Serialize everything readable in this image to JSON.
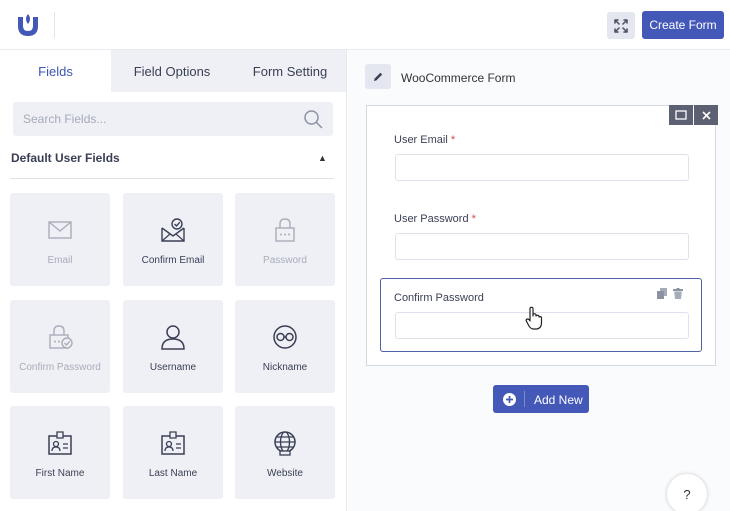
{
  "header": {
    "create_label": "Create Form",
    "brand_color": "#4458b8"
  },
  "tabs": [
    {
      "label": "Fields",
      "active": true
    },
    {
      "label": "Field Options",
      "active": false
    },
    {
      "label": "Form Setting",
      "active": false
    }
  ],
  "search": {
    "placeholder": "Search Fields...",
    "value": ""
  },
  "section": {
    "title": "Default User Fields",
    "expanded": true
  },
  "fields": [
    {
      "label": "Email",
      "icon": "envelope-icon",
      "muted": true
    },
    {
      "label": "Confirm Email",
      "icon": "envelope-check-icon",
      "muted": false
    },
    {
      "label": "Password",
      "icon": "lock-icon",
      "muted": true
    },
    {
      "label": "Confirm Password",
      "icon": "lock-check-icon",
      "muted": true
    },
    {
      "label": "Username",
      "icon": "user-icon",
      "muted": false
    },
    {
      "label": "Nickname",
      "icon": "mask-icon",
      "muted": false
    },
    {
      "label": "First Name",
      "icon": "id-card-icon",
      "muted": false
    },
    {
      "label": "Last Name",
      "icon": "id-card-icon",
      "muted": false
    },
    {
      "label": "Website",
      "icon": "globe-icon",
      "muted": false
    }
  ],
  "form": {
    "name": "WooCommerce Form",
    "rows": [
      {
        "label": "User Email",
        "required_mark": "*",
        "value": ""
      },
      {
        "label": "User Password",
        "required_mark": "*",
        "value": ""
      },
      {
        "label": "Confirm Password",
        "required_mark": "",
        "value": ""
      }
    ],
    "add_label": "Add New"
  },
  "help": {
    "label": "?"
  }
}
